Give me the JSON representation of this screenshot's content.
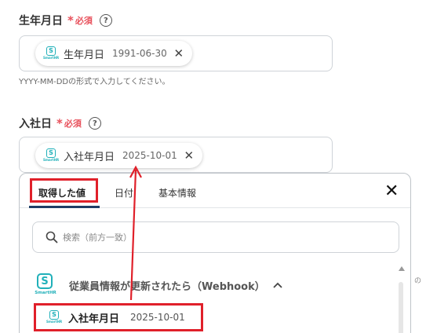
{
  "birth_field": {
    "label": "生年月日",
    "required_star": "*",
    "required_text": "必須",
    "help": "?",
    "chip": {
      "app_icon_letter": "S",
      "app_icon_caption": "SmartHR",
      "name": "生年月日",
      "value": "1991-06-30",
      "remove": "✕"
    },
    "hint": "YYYY-MM-DDの形式で入力してください。"
  },
  "hire_field": {
    "label": "入社日",
    "required_star": "*",
    "required_text": "必須",
    "help": "?",
    "chip": {
      "app_icon_letter": "S",
      "app_icon_caption": "SmartHR",
      "name": "入社年月日",
      "value": "2025-10-01",
      "remove": "✕"
    }
  },
  "picker": {
    "tabs": [
      "取得した値",
      "日付",
      "基本情報"
    ],
    "active_tab": "取得した値",
    "close": "✕",
    "search_placeholder": "検索（前方一致）",
    "group": {
      "app_icon_letter": "S",
      "app_icon_caption": "SmartHR",
      "title": "従業員情報が更新されたら（Webhook）"
    },
    "item": {
      "app_icon_letter": "S",
      "app_icon_caption": "SmartHR",
      "name": "入社年月日",
      "value": "2025-10-01"
    }
  },
  "offscreen_text": "の",
  "colors": {
    "required": "#e8505b",
    "highlight": "#e0202a",
    "brand": "#20b0b9",
    "tab_underline": "#1e3e66"
  }
}
